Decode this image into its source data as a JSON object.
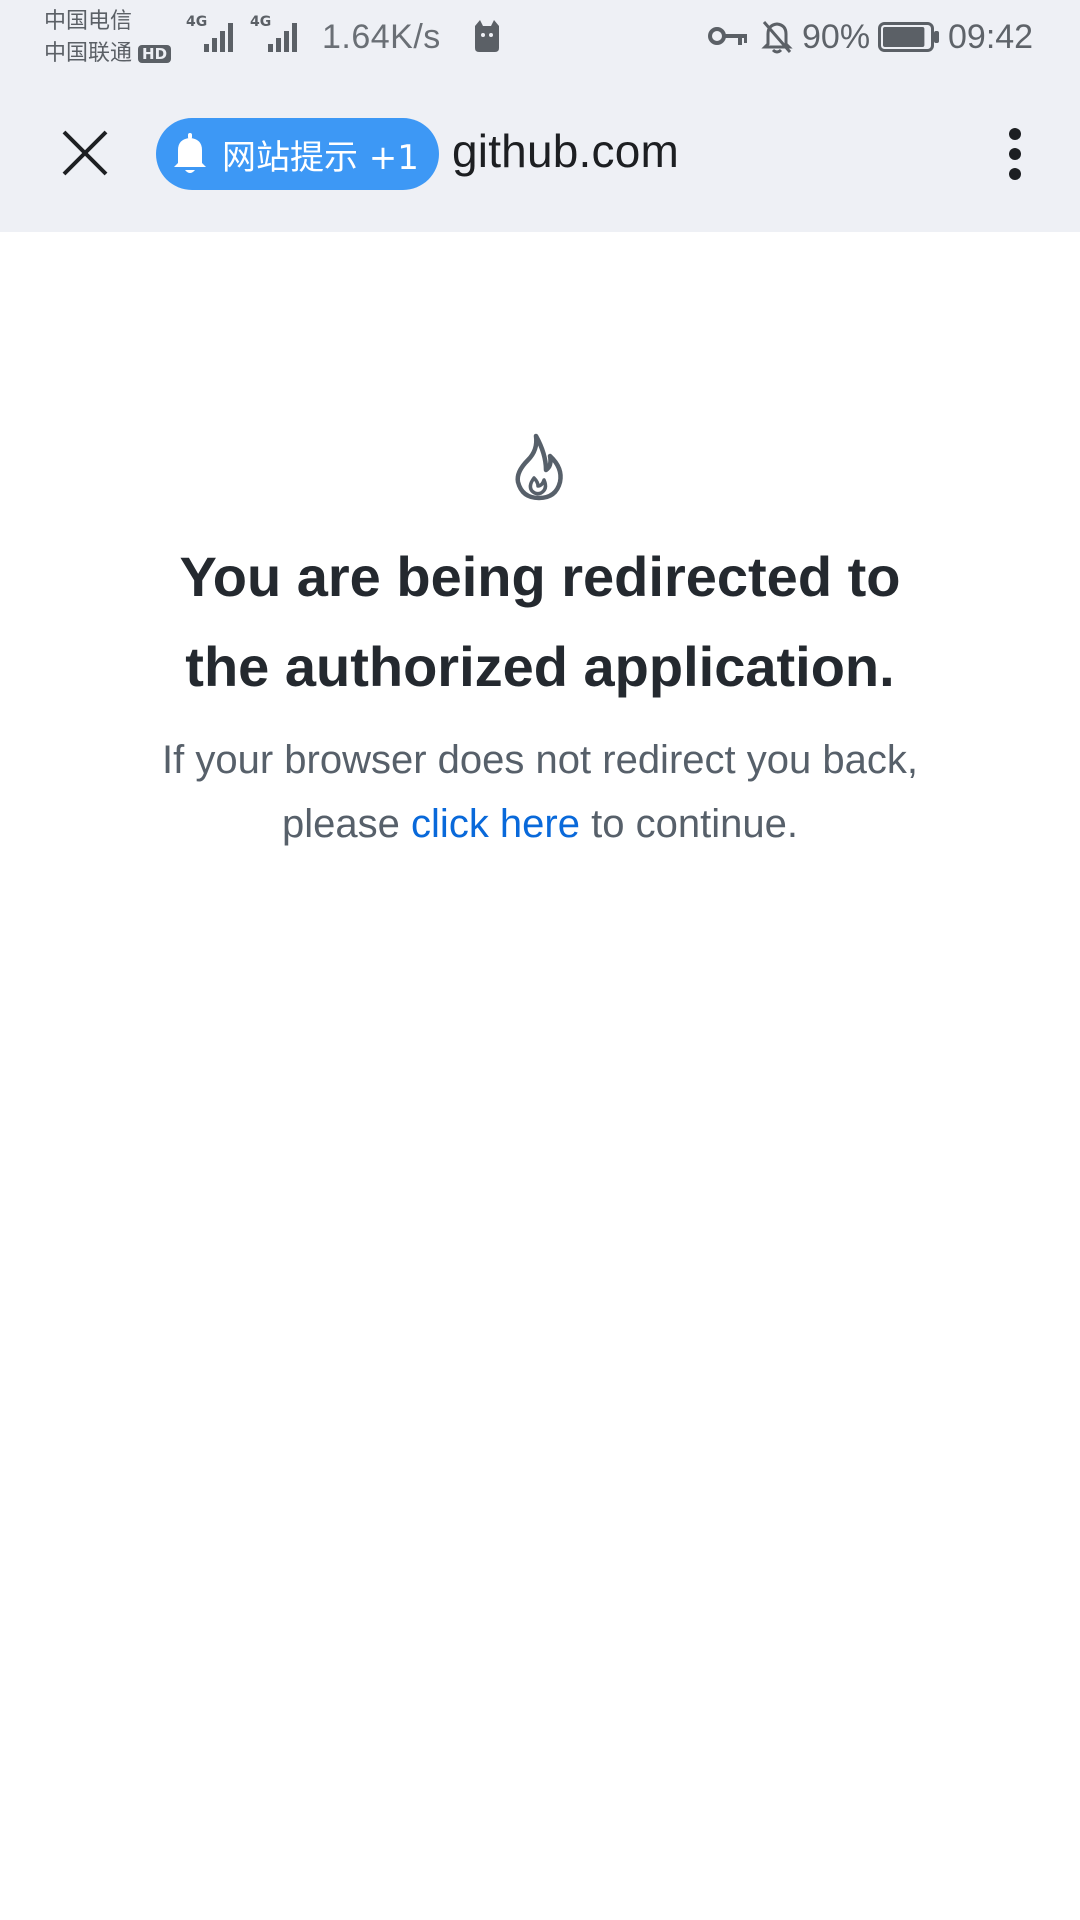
{
  "status_bar": {
    "carrier_1": "中国电信",
    "carrier_2": "中国联通",
    "hd_badge": "HD",
    "signal_1_label": "4G",
    "signal_2_label": "4G",
    "net_speed": "1.64K/s",
    "battery_percent": "90%",
    "battery_level": 0.9,
    "time": "09:42",
    "icons": [
      "cat-icon",
      "key-icon",
      "bell-off-icon",
      "battery-icon"
    ]
  },
  "toolbar": {
    "notice_label": "网站提示 +1",
    "domain": "github.com",
    "accent_color": "#3d98f5",
    "icons": [
      "close-icon",
      "bell-icon",
      "more-vertical-icon"
    ]
  },
  "page": {
    "icon": "flame-icon",
    "heading_line_1": "You are being redirected to",
    "heading_line_2": "the authorized application.",
    "message_prefix": "If your browser does not redirect you back,",
    "message_please": "please",
    "link_text": "click here",
    "message_suffix": "to continue.",
    "link_color": "#0969da"
  }
}
